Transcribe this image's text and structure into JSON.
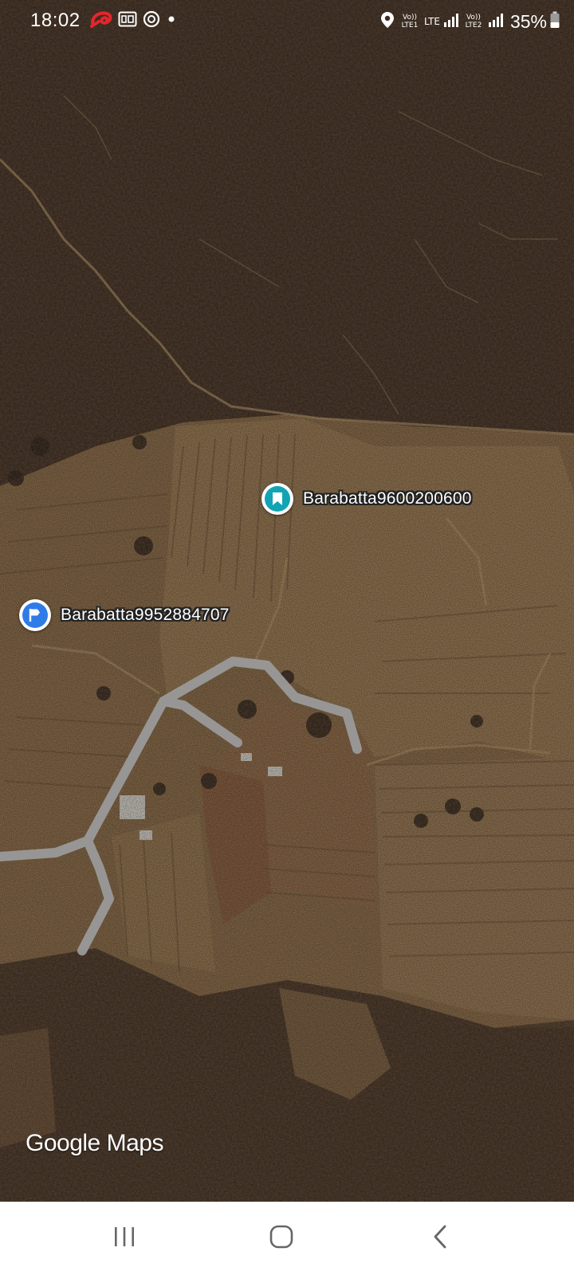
{
  "status_bar": {
    "time": "18:02",
    "left_icons": [
      "airtel-icon",
      "hd-icon",
      "data-saver-icon",
      "dot-icon"
    ],
    "sim1_label": "Vo)) LTE1",
    "lte_label": "LTE",
    "sim2_label": "Vo)) LTE2",
    "battery": "35%"
  },
  "markers": [
    {
      "label": "Barabatta9600200600",
      "icon": "bookmark-icon",
      "color": "#12a4b4"
    },
    {
      "label": "Barabatta9952884707",
      "icon": "flag-icon",
      "color": "#2f7ce8"
    }
  ],
  "watermark": {
    "google": "Google",
    "maps": "Maps"
  },
  "nav_bar": {
    "buttons": [
      "recent-apps-icon",
      "home-icon",
      "back-icon"
    ],
    "background": "#ffffff"
  },
  "colors": {
    "road": "#9a9a9a",
    "forest": "#3b2b22",
    "fields": "#8a6a45"
  }
}
